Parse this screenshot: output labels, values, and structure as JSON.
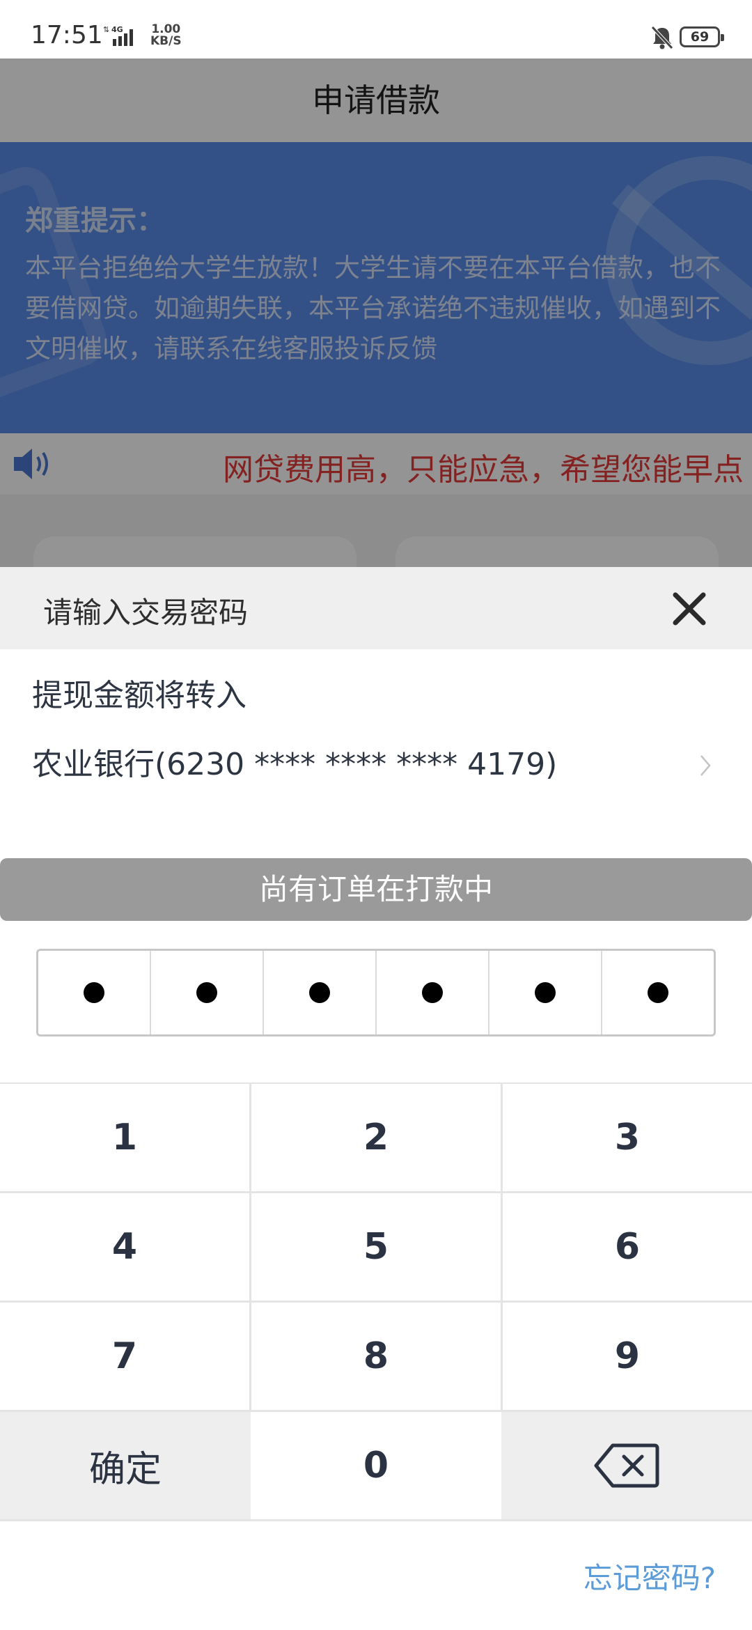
{
  "status_bar": {
    "time": "17:51",
    "network": "4G",
    "speed_value": "1.00",
    "speed_unit": "KB/S",
    "battery": "69"
  },
  "header": {
    "title": "申请借款"
  },
  "notice": {
    "title": "郑重提示：",
    "body": "本平台拒绝给大学生放款！大学生请不要在本平台借款，也不要借网贷。如逾期失联，本平台承诺绝不违规催收，如遇到不文明催收，请联系在线客服投诉反馈"
  },
  "marquee": {
    "text": "网贷费用高，只能应急，希望您能早点"
  },
  "sheet": {
    "title": "请输入交易密码",
    "transfer_label": "提现金额将转入",
    "bank_account": "农业银行(6230 **** **** **** 4179)",
    "order_status": "尚有订单在打款中",
    "pin_length": 6,
    "pin_filled": 6,
    "keys": [
      "1",
      "2",
      "3",
      "4",
      "5",
      "6",
      "7",
      "8",
      "9"
    ],
    "confirm_label": "确定",
    "zero_label": "0",
    "forgot_label": "忘记密码?"
  },
  "colors": {
    "banner": "#5a8ce8",
    "marquee_text": "#e43a3a",
    "link": "#5a9bd8",
    "order_status_bg": "#9a9a9a"
  }
}
